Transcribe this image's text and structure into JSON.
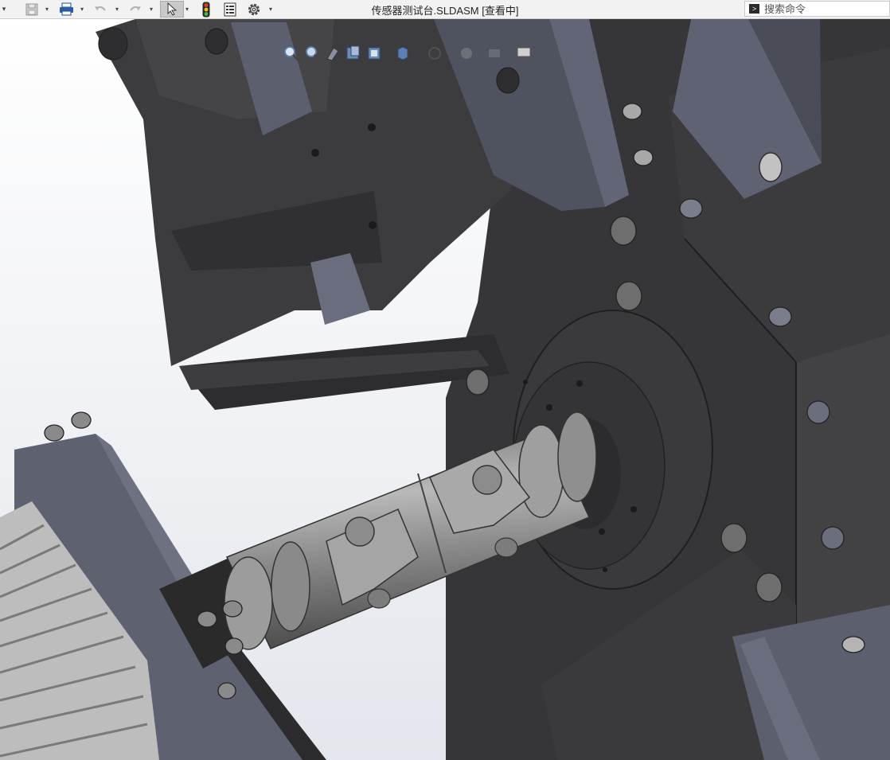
{
  "window": {
    "title": "传感器测试台.SLDASM [查看中]"
  },
  "toolbar": {
    "items": [
      {
        "name": "dropdown-arrow",
        "icon": "chevron-down-icon"
      },
      {
        "name": "save",
        "icon": "save-icon"
      },
      {
        "name": "print",
        "icon": "printer-icon"
      },
      {
        "name": "undo",
        "icon": "undo-icon"
      },
      {
        "name": "redo",
        "icon": "redo-icon"
      },
      {
        "name": "select",
        "icon": "cursor-arrow-icon"
      },
      {
        "name": "rebuild",
        "icon": "traffic-light-icon"
      },
      {
        "name": "file-properties",
        "icon": "file-properties-icon"
      },
      {
        "name": "options",
        "icon": "gear-icon"
      }
    ]
  },
  "search": {
    "placeholder": "搜索命令",
    "icon": "command-prompt-icon"
  },
  "heads_up_toolbar": {
    "items": [
      "zoom-to-fit-icon",
      "zoom-area-icon",
      "previous-view-icon",
      "section-view-icon",
      "view-orientation-icon",
      "display-style-icon",
      "hide-show-items-icon",
      "edit-appearance-icon",
      "apply-scene-icon",
      "view-settings-icon"
    ]
  },
  "colors": {
    "viewport_background": "#f4f5f7",
    "part_dark": "#3a3a3c",
    "part_blue_grey": "#5e6170",
    "part_steel": "#a8a8a8"
  }
}
